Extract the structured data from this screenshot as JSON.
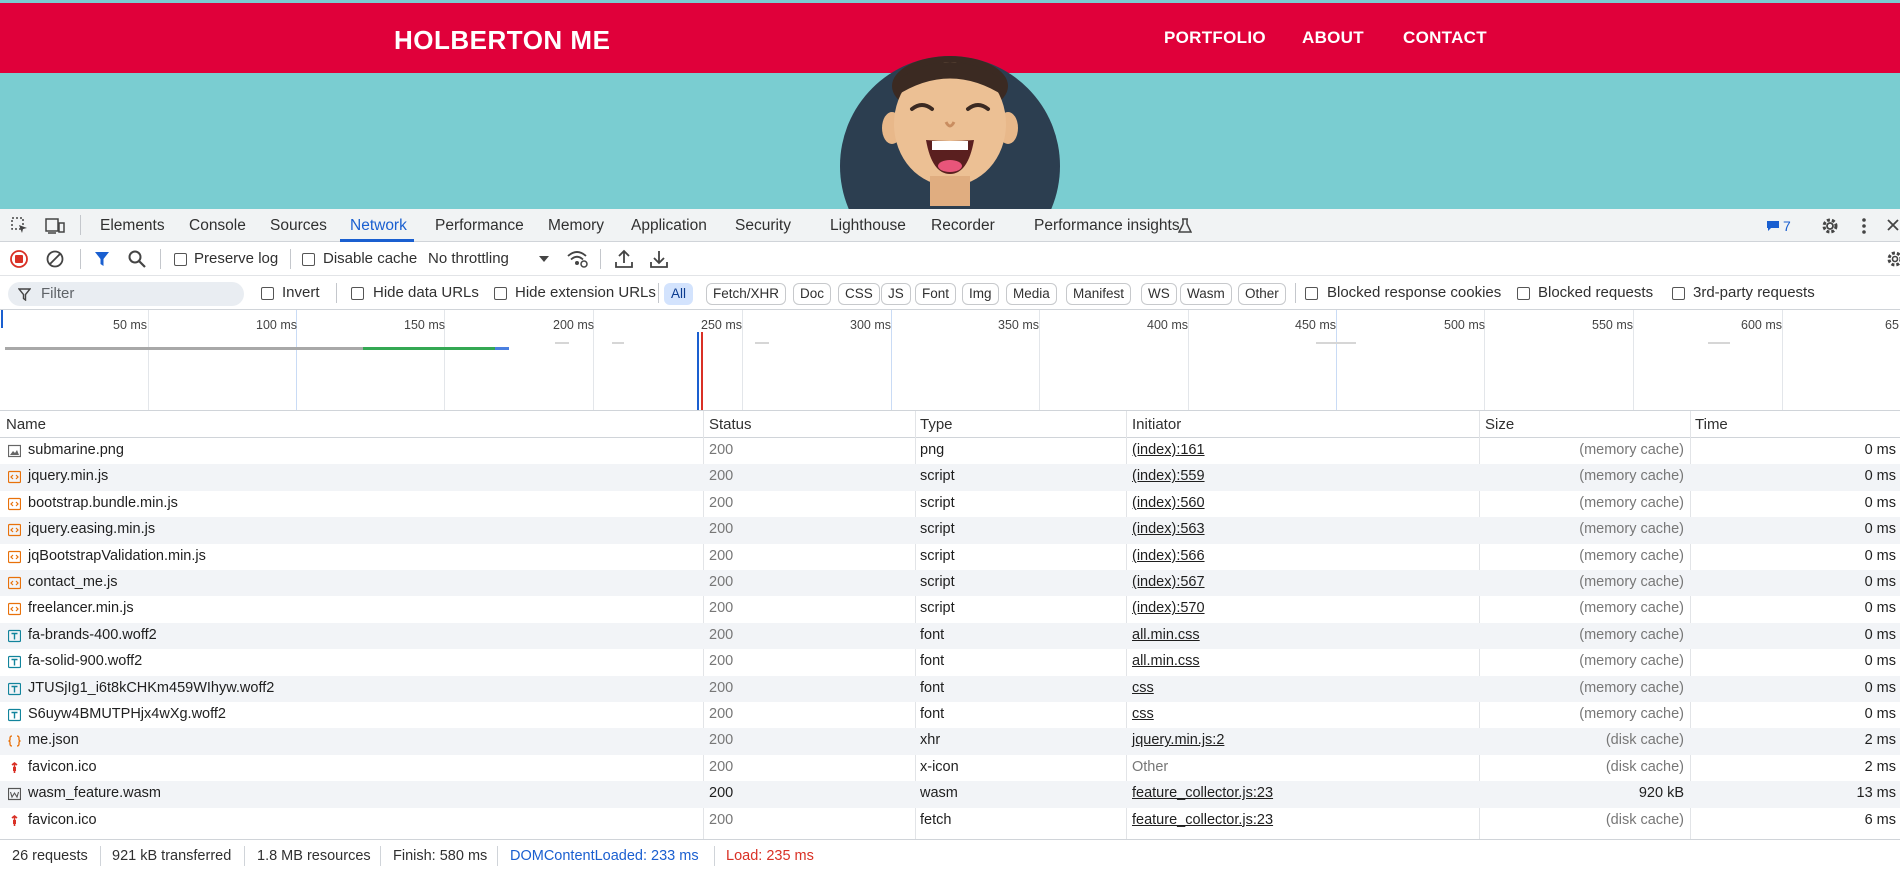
{
  "site": {
    "brand": "HOLBERTON ME",
    "nav": [
      "PORTFOLIO",
      "ABOUT",
      "CONTACT"
    ],
    "colors": {
      "nav_bg": "#e0003a",
      "hero_bg": "#7acdd1",
      "avatar_bg": "#2c3e50"
    }
  },
  "devtools": {
    "tabs": [
      "Elements",
      "Console",
      "Sources",
      "Network",
      "Performance",
      "Memory",
      "Application",
      "Security",
      "Lighthouse",
      "Recorder",
      "Performance insights"
    ],
    "active_tab": "Network",
    "issues_count": "7",
    "toolbar": {
      "preserve_log": "Preserve log",
      "disable_cache": "Disable cache",
      "throttling": "No throttling"
    },
    "filter": {
      "placeholder": "Filter",
      "invert": "Invert",
      "hide_data_urls": "Hide data URLs",
      "hide_extension_urls": "Hide extension URLs",
      "types": [
        "All",
        "Fetch/XHR",
        "Doc",
        "CSS",
        "JS",
        "Font",
        "Img",
        "Media",
        "Manifest",
        "WS",
        "Wasm",
        "Other"
      ],
      "active_type": "All",
      "blocked_response_cookies": "Blocked response cookies",
      "blocked_requests": "Blocked requests",
      "third_party": "3rd-party requests"
    },
    "overview_ticks": [
      "50 ms",
      "100 ms",
      "150 ms",
      "200 ms",
      "250 ms",
      "300 ms",
      "350 ms",
      "400 ms",
      "450 ms",
      "500 ms",
      "550 ms",
      "600 ms",
      "65"
    ],
    "columns": {
      "name": "Name",
      "status": "Status",
      "type": "Type",
      "initiator": "Initiator",
      "size": "Size",
      "time": "Time"
    },
    "requests": [
      {
        "name": "submarine.png",
        "status": "200",
        "type": "png",
        "initiator": "(index):161",
        "size": "(memory cache)",
        "time": "0 ms",
        "icon": "image-file-icon"
      },
      {
        "name": "jquery.min.js",
        "status": "200",
        "type": "script",
        "initiator": "(index):559",
        "size": "(memory cache)",
        "time": "0 ms",
        "icon": "script-file-icon"
      },
      {
        "name": "bootstrap.bundle.min.js",
        "status": "200",
        "type": "script",
        "initiator": "(index):560",
        "size": "(memory cache)",
        "time": "0 ms",
        "icon": "script-file-icon"
      },
      {
        "name": "jquery.easing.min.js",
        "status": "200",
        "type": "script",
        "initiator": "(index):563",
        "size": "(memory cache)",
        "time": "0 ms",
        "icon": "script-file-icon"
      },
      {
        "name": "jqBootstrapValidation.min.js",
        "status": "200",
        "type": "script",
        "initiator": "(index):566",
        "size": "(memory cache)",
        "time": "0 ms",
        "icon": "script-file-icon"
      },
      {
        "name": "contact_me.js",
        "status": "200",
        "type": "script",
        "initiator": "(index):567",
        "size": "(memory cache)",
        "time": "0 ms",
        "icon": "script-file-icon"
      },
      {
        "name": "freelancer.min.js",
        "status": "200",
        "type": "script",
        "initiator": "(index):570",
        "size": "(memory cache)",
        "time": "0 ms",
        "icon": "script-file-icon"
      },
      {
        "name": "fa-brands-400.woff2",
        "status": "200",
        "type": "font",
        "initiator": "all.min.css",
        "size": "(memory cache)",
        "time": "0 ms",
        "icon": "font-file-icon"
      },
      {
        "name": "fa-solid-900.woff2",
        "status": "200",
        "type": "font",
        "initiator": "all.min.css",
        "size": "(memory cache)",
        "time": "0 ms",
        "icon": "font-file-icon"
      },
      {
        "name": "JTUSjIg1_i6t8kCHKm459WIhyw.woff2",
        "status": "200",
        "type": "font",
        "initiator": "css",
        "size": "(memory cache)",
        "time": "0 ms",
        "icon": "font-file-icon"
      },
      {
        "name": "S6uyw4BMUTPHjx4wXg.woff2",
        "status": "200",
        "type": "font",
        "initiator": "css",
        "size": "(memory cache)",
        "time": "0 ms",
        "icon": "font-file-icon"
      },
      {
        "name": "me.json",
        "status": "200",
        "type": "xhr",
        "initiator": "jquery.min.js:2",
        "size": "(disk cache)",
        "time": "2 ms",
        "icon": "json-file-icon"
      },
      {
        "name": "favicon.ico",
        "status": "200",
        "type": "x-icon",
        "initiator": "Other",
        "size": "(disk cache)",
        "time": "2 ms",
        "icon": "favicon-file-icon"
      },
      {
        "name": "wasm_feature.wasm",
        "status": "200",
        "type": "wasm",
        "initiator": "feature_collector.js:23",
        "size": "920 kB",
        "time": "13 ms",
        "icon": "wasm-file-icon"
      },
      {
        "name": "favicon.ico",
        "status": "200",
        "type": "fetch",
        "initiator": "feature_collector.js:23",
        "size": "(disk cache)",
        "time": "6 ms",
        "icon": "favicon-file-icon"
      }
    ],
    "status_bar": {
      "requests": "26 requests",
      "transferred": "921 kB transferred",
      "resources": "1.8 MB resources",
      "finish": "Finish: 580 ms",
      "dom_content_loaded": "DOMContentLoaded: 233 ms",
      "load": "Load: 235 ms"
    }
  }
}
